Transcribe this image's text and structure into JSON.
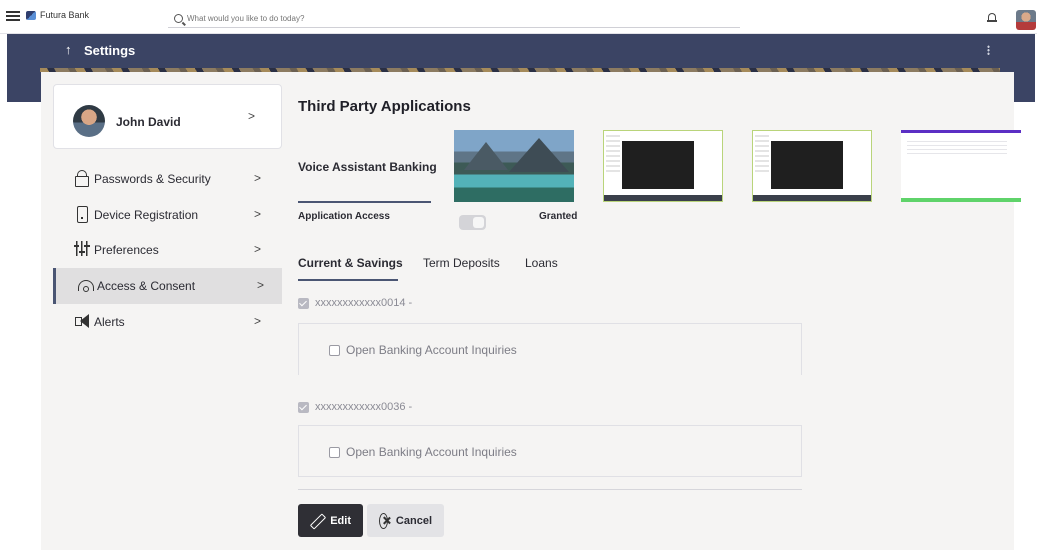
{
  "topbar": {
    "brand": "Futura Bank",
    "search_placeholder": "What would you like to do today?"
  },
  "header": {
    "back_glyph": "↑",
    "title": "Settings"
  },
  "profile": {
    "name": "John David"
  },
  "sidebar": {
    "items": [
      {
        "label": "Passwords & Security",
        "icon": "lock-icon"
      },
      {
        "label": "Device Registration",
        "icon": "device-icon"
      },
      {
        "label": "Preferences",
        "icon": "sliders-icon"
      },
      {
        "label": "Access & Consent",
        "icon": "consent-icon",
        "active": true
      },
      {
        "label": "Alerts",
        "icon": "megaphone-icon"
      }
    ],
    "chevron": ">"
  },
  "content": {
    "title": "Third Party Applications",
    "app_name": "Voice Assistant Banking",
    "access_label": "Application Access",
    "access_status": "Granted",
    "tabs": [
      "Current & Savings",
      "Term Deposits",
      "Loans"
    ],
    "accounts": [
      {
        "number": "xxxxxxxxxxxx0014 -",
        "checked": true,
        "permission": "Open Banking Account Inquiries"
      },
      {
        "number": "xxxxxxxxxxxx0036 -",
        "checked": true,
        "permission": "Open Banking Account Inquiries"
      }
    ],
    "edit_label": "Edit",
    "cancel_label": "Cancel"
  },
  "colors": {
    "header_bg": "#3b4464",
    "accent": "#4a5573",
    "edit_button_bg": "#2f2f35"
  }
}
